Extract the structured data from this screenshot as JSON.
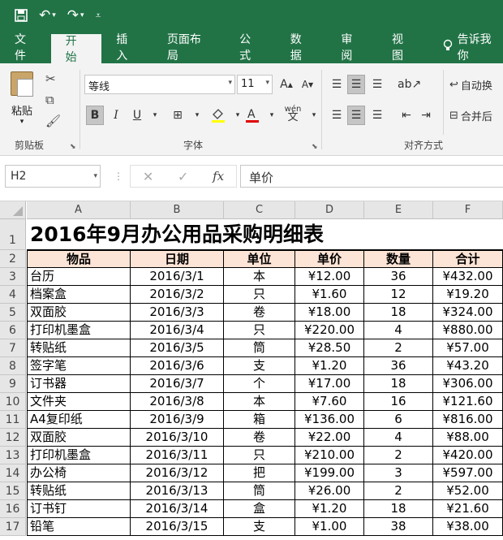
{
  "quick_access": {
    "save_icon": "save-icon",
    "undo_icon": "undo-icon",
    "redo_icon": "redo-icon",
    "customize_icon": "customize-icon"
  },
  "tabs": [
    {
      "label": "文件"
    },
    {
      "label": "开始"
    },
    {
      "label": "插入"
    },
    {
      "label": "页面布局"
    },
    {
      "label": "公式"
    },
    {
      "label": "数据"
    },
    {
      "label": "审阅"
    },
    {
      "label": "视图"
    }
  ],
  "tell_me": "告诉我你",
  "ribbon": {
    "clipboard": {
      "paste_label": "粘贴",
      "group_label": "剪贴板"
    },
    "font": {
      "font_name": "等线",
      "font_size": "11",
      "group_label": "字体",
      "bold": "B",
      "italic": "I",
      "underline": "U"
    },
    "align": {
      "wrap_label": "自动换",
      "merge_label": "合并后",
      "group_label": "对齐方式"
    }
  },
  "formula_bar": {
    "name_box": "H2",
    "fx": "fx",
    "value": "单价"
  },
  "columns": [
    "A",
    "B",
    "C",
    "D",
    "E",
    "F"
  ],
  "sheet": {
    "title": "2016年9月办公用品采购明细表",
    "headers": [
      "物品",
      "日期",
      "单位",
      "单价",
      "数量",
      "合计"
    ],
    "rows": [
      [
        "台历",
        "2016/3/1",
        "本",
        "¥12.00",
        "36",
        "¥432.00"
      ],
      [
        "档案盒",
        "2016/3/2",
        "只",
        "¥1.60",
        "12",
        "¥19.20"
      ],
      [
        "双面胶",
        "2016/3/3",
        "卷",
        "¥18.00",
        "18",
        "¥324.00"
      ],
      [
        "打印机墨盒",
        "2016/3/4",
        "只",
        "¥220.00",
        "4",
        "¥880.00"
      ],
      [
        "转贴纸",
        "2016/3/5",
        "筒",
        "¥28.50",
        "2",
        "¥57.00"
      ],
      [
        "签字笔",
        "2016/3/6",
        "支",
        "¥1.20",
        "36",
        "¥43.20"
      ],
      [
        "订书器",
        "2016/3/7",
        "个",
        "¥17.00",
        "18",
        "¥306.00"
      ],
      [
        "文件夹",
        "2016/3/8",
        "本",
        "¥7.60",
        "16",
        "¥121.60"
      ],
      [
        "A4复印纸",
        "2016/3/9",
        "箱",
        "¥136.00",
        "6",
        "¥816.00"
      ],
      [
        "双面胶",
        "2016/3/10",
        "卷",
        "¥22.00",
        "4",
        "¥88.00"
      ],
      [
        "打印机墨盒",
        "2016/3/11",
        "只",
        "¥210.00",
        "2",
        "¥420.00"
      ],
      [
        "办公椅",
        "2016/3/12",
        "把",
        "¥199.00",
        "3",
        "¥597.00"
      ],
      [
        "转贴纸",
        "2016/3/13",
        "筒",
        "¥26.00",
        "2",
        "¥52.00"
      ],
      [
        "订书钉",
        "2016/3/14",
        "盒",
        "¥1.20",
        "18",
        "¥21.60"
      ],
      [
        "铅笔",
        "2016/3/15",
        "支",
        "¥1.00",
        "38",
        "¥38.00"
      ]
    ]
  },
  "colors": {
    "excel_green": "#217346",
    "header_fill": "#fce4d6"
  }
}
